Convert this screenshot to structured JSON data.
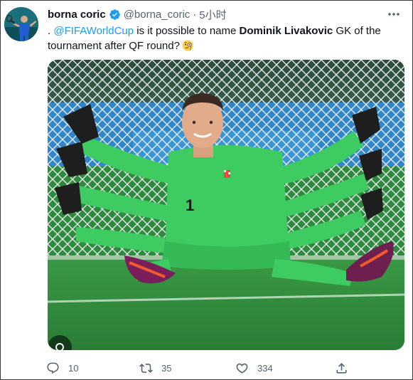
{
  "tweet": {
    "author_name": "borna coric",
    "author_handle": "@borna_coric",
    "separator": "·",
    "timestamp": "5小时",
    "text": {
      "prefix": ". ",
      "mention": "@FIFAWorldCup",
      "mid": " is it possible to name ",
      "bold": "Dominik Livakovic",
      "suffix": " GK of the tournament after QF round?"
    },
    "emoji": "face-with-monocle",
    "media": {
      "kind": "photo",
      "shirt_number": "1"
    }
  },
  "actions": {
    "reply": {
      "icon": "reply-icon",
      "count": "10"
    },
    "retweet": {
      "icon": "retweet-icon",
      "count": "35"
    },
    "like": {
      "icon": "heart-icon",
      "count": "334"
    },
    "share": {
      "icon": "share-icon",
      "count": ""
    }
  },
  "colors": {
    "link": "#1d9bf0",
    "verified": "#1d9bf0",
    "muted": "#536471",
    "text": "#0f1419",
    "jersey": "#3ecb62",
    "pitch": "#2e8a3c"
  }
}
